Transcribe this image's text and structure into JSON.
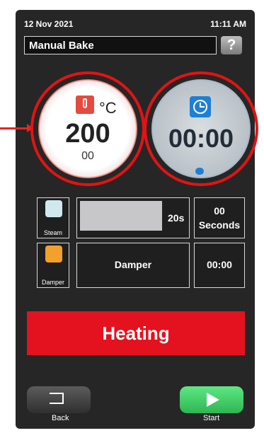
{
  "status_bar": {
    "date": "12 Nov 2021",
    "time": "11:11 AM"
  },
  "header": {
    "program_name": "Manual Bake",
    "help_icon_text": "?"
  },
  "temperature": {
    "value": "200",
    "sub_value": "00",
    "unit": "°C",
    "icon": "thermometer-icon"
  },
  "timer": {
    "value": "00:00",
    "icon": "clock-icon"
  },
  "steam": {
    "label": "Steam",
    "progress_text": "20s",
    "value_line1": "00",
    "value_line2": "Seconds",
    "icon": "steam-icon"
  },
  "damper": {
    "label": "Damper",
    "center_text": "Damper",
    "value": "00:00",
    "icon": "damper-icon"
  },
  "primary_action": {
    "label": "Heating",
    "color": "#e3121e"
  },
  "footer": {
    "back_label": "Back",
    "start_label": "Start",
    "back_icon": "back-icon",
    "start_icon": "play-icon"
  },
  "annotations": {
    "arrow_color": "#e8251f",
    "highlight_color": "#e31313"
  }
}
